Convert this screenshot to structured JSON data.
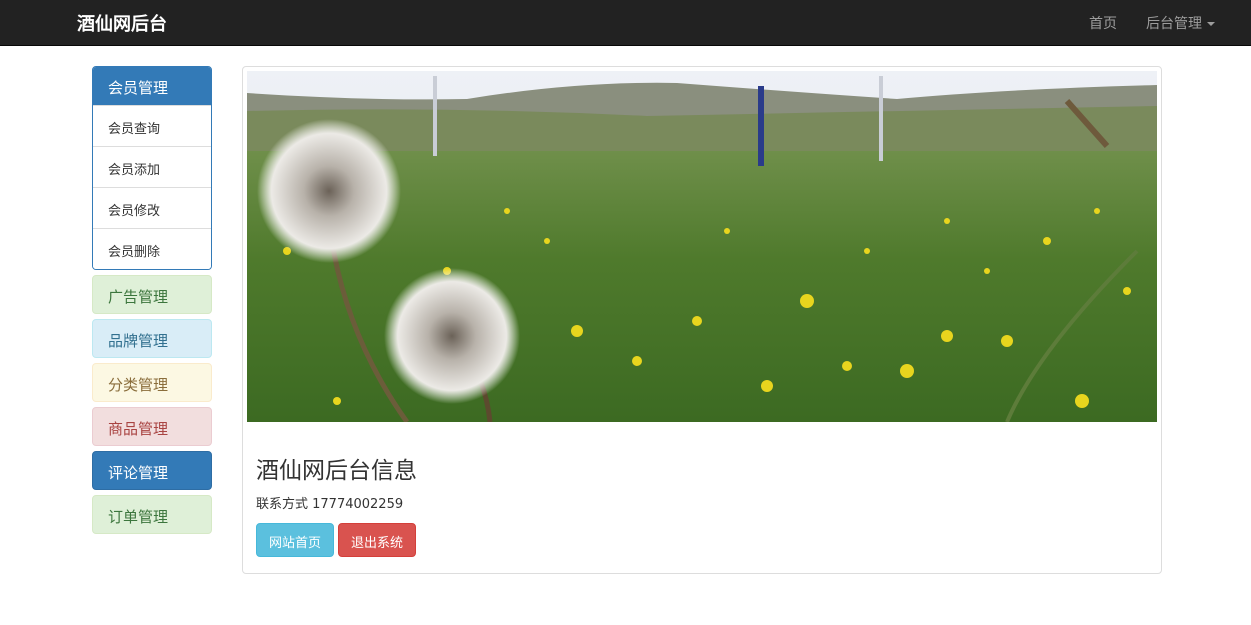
{
  "navbar": {
    "brand": "酒仙网后台",
    "home_label": "首页",
    "admin_label": "后台管理"
  },
  "sidebar": {
    "member_title": "会员管理",
    "member_items": [
      "会员查询",
      "会员添加",
      "会员修改",
      "会员删除"
    ],
    "panels": {
      "ads": "广告管理",
      "brand": "品牌管理",
      "category": "分类管理",
      "goods": "商品管理",
      "comments": "评论管理",
      "orders": "订单管理"
    }
  },
  "main": {
    "title": "酒仙网后台信息",
    "contact": "联系方式 17774002259",
    "home_button": "网站首页",
    "logout_button": "退出系统"
  },
  "colors": {
    "navbar_bg": "#222222",
    "primary": "#337ab7",
    "success_bg": "#dff0d8",
    "info_bg": "#d9edf7",
    "warning_bg": "#fcf8e3",
    "danger_bg": "#f2dede",
    "btn_info": "#5bc0de",
    "btn_danger": "#d9534f"
  }
}
